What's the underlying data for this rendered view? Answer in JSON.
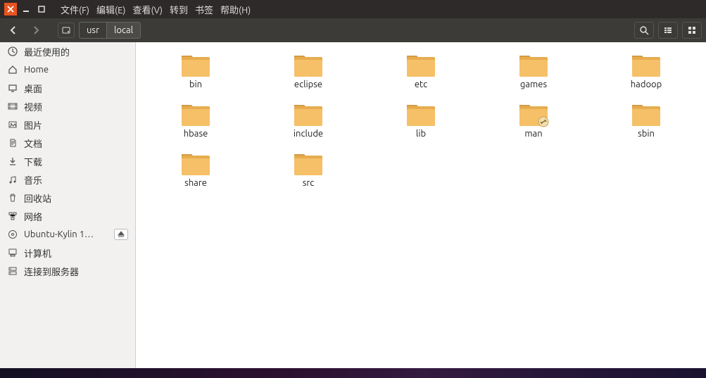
{
  "titlebar": {
    "menus": [
      "文件(F)",
      "编辑(E)",
      "查看(V)",
      "转到",
      "书签",
      "帮助(H)"
    ]
  },
  "toolbar": {
    "path": [
      "usr",
      "local"
    ]
  },
  "sidebar": {
    "items": [
      {
        "icon": "clock-icon",
        "label": "最近使用的"
      },
      {
        "icon": "home-icon",
        "label": "Home"
      },
      {
        "icon": "desktop-icon",
        "label": "桌面"
      },
      {
        "icon": "video-icon",
        "label": "视频"
      },
      {
        "icon": "pictures-icon",
        "label": "图片"
      },
      {
        "icon": "documents-icon",
        "label": "文档"
      },
      {
        "icon": "download-icon",
        "label": "下载"
      },
      {
        "icon": "music-icon",
        "label": "音乐"
      },
      {
        "icon": "trash-icon",
        "label": "回收站"
      },
      {
        "icon": "network-icon",
        "label": "网络"
      },
      {
        "icon": "disc-icon",
        "label": "Ubuntu-Kylin 1…",
        "eject": true
      },
      {
        "icon": "computer-icon",
        "label": "计算机"
      },
      {
        "icon": "server-icon",
        "label": "连接到服务器"
      }
    ]
  },
  "main": {
    "folders": [
      {
        "name": "bin",
        "link": false
      },
      {
        "name": "eclipse",
        "link": false
      },
      {
        "name": "etc",
        "link": false
      },
      {
        "name": "games",
        "link": false
      },
      {
        "name": "hadoop",
        "link": false
      },
      {
        "name": "hbase",
        "link": false
      },
      {
        "name": "include",
        "link": false
      },
      {
        "name": "lib",
        "link": false
      },
      {
        "name": "man",
        "link": true
      },
      {
        "name": "sbin",
        "link": false
      },
      {
        "name": "share",
        "link": false
      },
      {
        "name": "src",
        "link": false
      }
    ]
  }
}
